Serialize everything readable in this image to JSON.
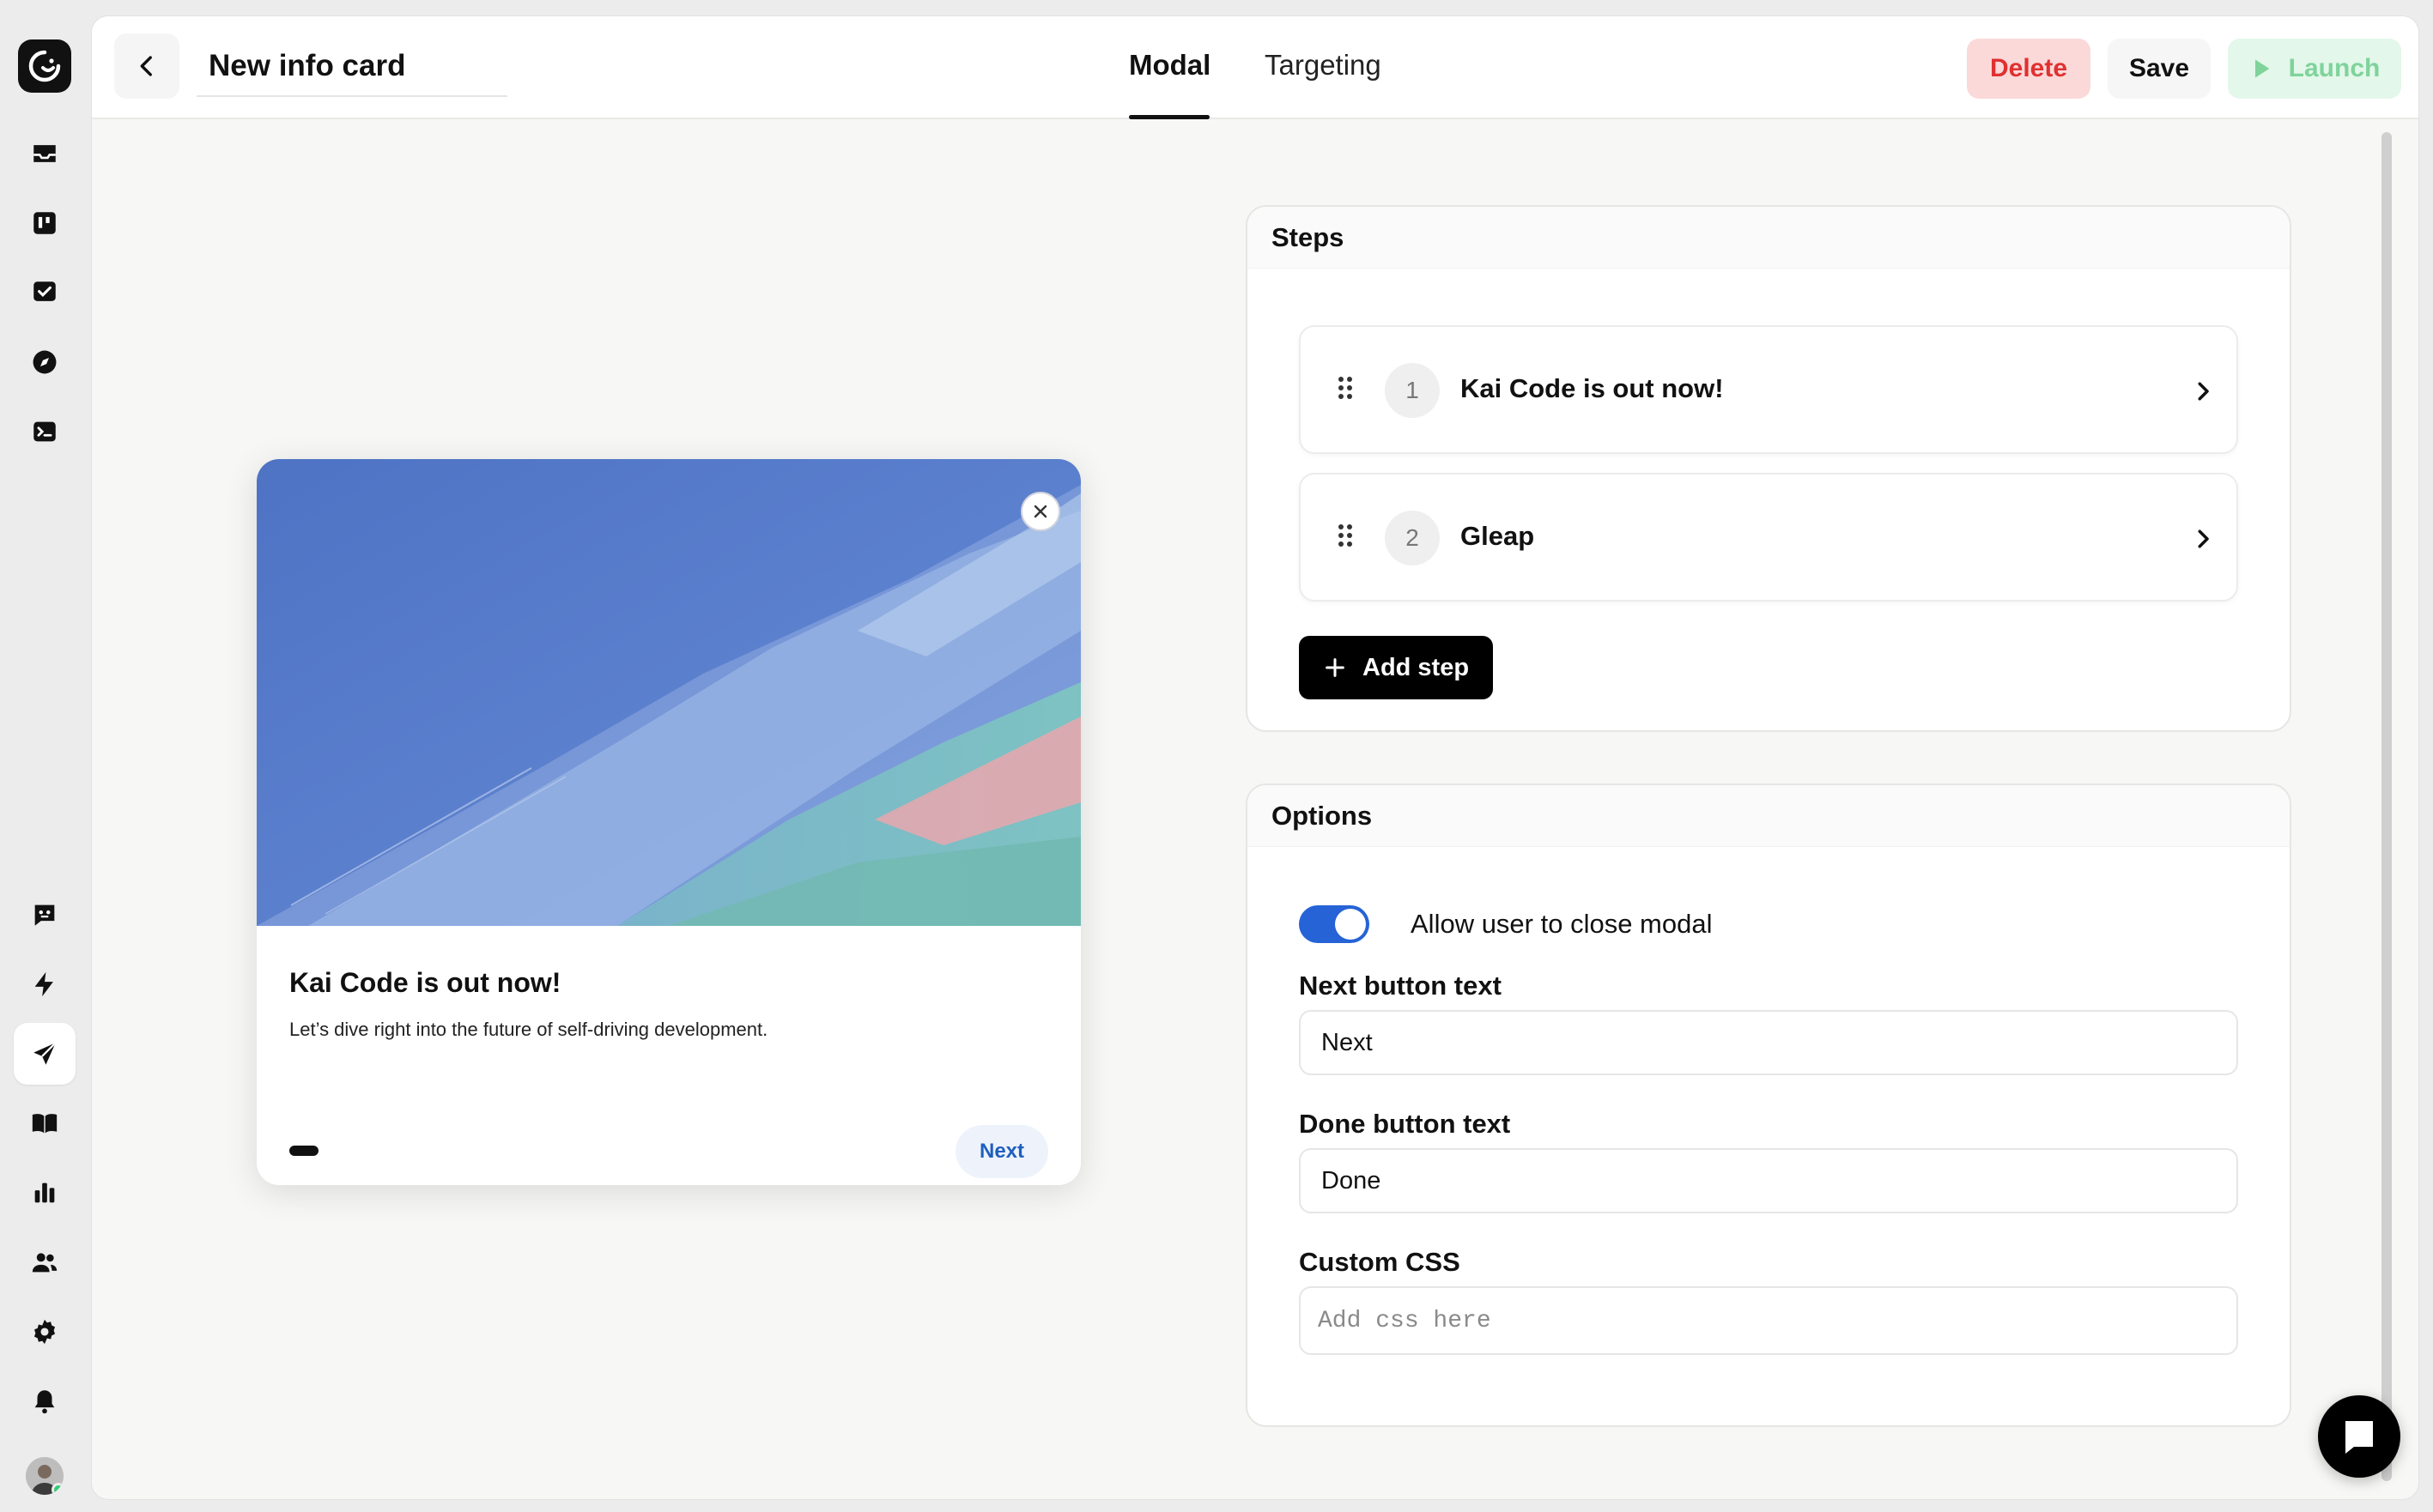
{
  "header": {
    "title_value": "New info card",
    "tabs": [
      {
        "label": "Modal",
        "active": true
      },
      {
        "label": "Targeting",
        "active": false
      }
    ],
    "delete_label": "Delete",
    "save_label": "Save",
    "launch_label": "Launch"
  },
  "sidebar": {
    "top_icons": [
      "inbox-icon",
      "board-icon",
      "checklist-icon",
      "compass-icon",
      "terminal-icon"
    ],
    "bottom_icons": [
      "bot-icon",
      "bolt-icon",
      "send-icon",
      "book-icon",
      "bar-chart-icon",
      "users-icon",
      "gear-icon",
      "bell-icon"
    ],
    "active": "send-icon"
  },
  "preview": {
    "title": "Kai Code is out now!",
    "description": "Let’s dive right into the future of self-driving development.",
    "next_label": "Next"
  },
  "steps": {
    "heading": "Steps",
    "items": [
      {
        "number": "1",
        "label": "Kai Code is out now!"
      },
      {
        "number": "2",
        "label": "Gleap"
      }
    ],
    "add_label": "Add step"
  },
  "options": {
    "heading": "Options",
    "allow_close_label": "Allow user to close modal",
    "allow_close_enabled": true,
    "next_button_label": "Next button text",
    "next_button_value": "Next",
    "done_button_label": "Done button text",
    "done_button_value": "Done",
    "custom_css_label": "Custom CSS",
    "custom_css_placeholder": "Add css here"
  },
  "colors": {
    "accent_blue": "#2563d6",
    "delete_red": "#e03131",
    "launch_green": "#7fd39b"
  }
}
